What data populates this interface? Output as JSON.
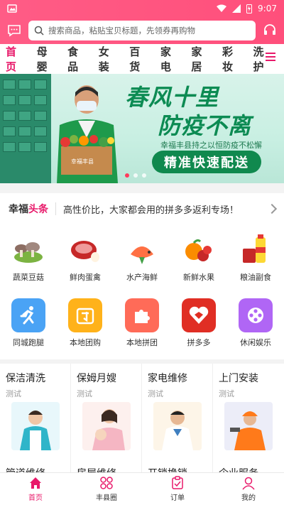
{
  "status": {
    "time": "9:07"
  },
  "search": {
    "placeholder": "搜索商品，粘贴宝贝标题，先领券再购物"
  },
  "tabs": [
    "首页",
    "母婴",
    "食品",
    "女装",
    "百货",
    "家电",
    "家居",
    "彩妆",
    "洗护"
  ],
  "banner": {
    "title_line1": "春风十里",
    "title_line2": "防疫不离",
    "subtitle": "幸福丰县持之以恒防疫不松懈",
    "pill": "精准快速配送",
    "box_label": "幸福丰县",
    "page_count": 3,
    "active_index": 0
  },
  "news": {
    "brand_a": "幸福",
    "brand_b": "头条",
    "text": "高性价比，大家都会用的拼多多返利专场！"
  },
  "grid_row1": [
    {
      "label": "蔬菜豆菇",
      "icon": "mushroom-icon"
    },
    {
      "label": "鲜肉蛋禽",
      "icon": "meat-icon"
    },
    {
      "label": "水产海鲜",
      "icon": "seafood-icon"
    },
    {
      "label": "新鲜水果",
      "icon": "fruit-icon"
    },
    {
      "label": "粮油副食",
      "icon": "grain-oil-icon"
    }
  ],
  "grid_row2": [
    {
      "label": "同城跑腿",
      "icon": "runner-icon",
      "color": "#4aa3f5"
    },
    {
      "label": "本地团购",
      "icon": "group-buy-icon",
      "color": "#ffb21a"
    },
    {
      "label": "本地拼团",
      "icon": "puzzle-icon",
      "color": "#ff6b58"
    },
    {
      "label": "拼多多",
      "icon": "pinduoduo-icon",
      "color": "#e02e24"
    },
    {
      "label": "休闲娱乐",
      "icon": "film-reel-icon",
      "color": "#b066f5"
    }
  ],
  "services": [
    {
      "title": "保洁清洗",
      "subtitle": "测试",
      "next": "管道维修"
    },
    {
      "title": "保姆月嫂",
      "subtitle": "测试",
      "next": "房屋维修"
    },
    {
      "title": "家电维修",
      "subtitle": "测试",
      "next": "开锁换锁"
    },
    {
      "title": "上门安装",
      "subtitle": "测试",
      "next": "企业服务"
    }
  ],
  "bottomnav": [
    {
      "label": "首页",
      "icon": "home-icon"
    },
    {
      "label": "丰县圈",
      "icon": "circle-icon"
    },
    {
      "label": "订单",
      "icon": "order-icon"
    },
    {
      "label": "我的",
      "icon": "profile-icon"
    }
  ],
  "colors": {
    "accent": "#e8196a",
    "header": "#ff5c86",
    "banner_green": "#0c8b53"
  }
}
